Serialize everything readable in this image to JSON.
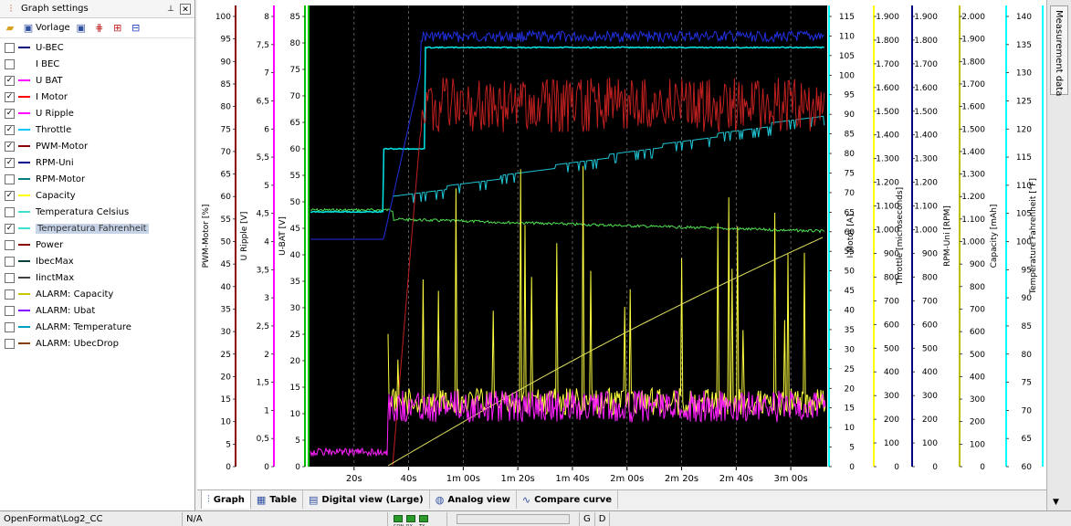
{
  "panel": {
    "title": "Graph settings",
    "toolbar": {
      "vorlage_label": "Vorlage"
    },
    "signals": [
      {
        "label": "U-BEC",
        "checked": false,
        "color": "#000080"
      },
      {
        "label": "I BEC",
        "checked": false,
        "color": "#ffffff"
      },
      {
        "label": "U BAT",
        "checked": true,
        "color": "#ff00ff"
      },
      {
        "label": "I Motor",
        "checked": true,
        "color": "#ff0000"
      },
      {
        "label": "U Ripple",
        "checked": true,
        "color": "#ff00ff"
      },
      {
        "label": "Throttle",
        "checked": true,
        "color": "#00c8ff"
      },
      {
        "label": "PWM-Motor",
        "checked": true,
        "color": "#8b0000"
      },
      {
        "label": "RPM-Uni",
        "checked": true,
        "color": "#00008b"
      },
      {
        "label": "RPM-Motor",
        "checked": false,
        "color": "#008080"
      },
      {
        "label": "Capacity",
        "checked": true,
        "color": "#ffff00"
      },
      {
        "label": "Temperatura Celsius",
        "checked": false,
        "color": "#40e0d0"
      },
      {
        "label": "Temperatura Fahrenheit",
        "checked": true,
        "color": "#40e0d0",
        "selected": true
      },
      {
        "label": "Power",
        "checked": false,
        "color": "#8b0000"
      },
      {
        "label": "IbecMax",
        "checked": false,
        "color": "#004040"
      },
      {
        "label": "IinctMax",
        "checked": false,
        "color": "#404040"
      },
      {
        "label": "ALARM: Capacity",
        "checked": false,
        "color": "#c8c800"
      },
      {
        "label": "ALARM: Ubat",
        "checked": false,
        "color": "#8000ff"
      },
      {
        "label": "ALARM: Temperature",
        "checked": false,
        "color": "#00a0c0"
      },
      {
        "label": "ALARM: UbecDrop",
        "checked": false,
        "color": "#804000"
      }
    ]
  },
  "graph": {
    "x_ticks": [
      "20s",
      "40s",
      "1m 00s",
      "1m 20s",
      "1m 40s",
      "2m 00s",
      "2m 20s",
      "2m 40s",
      "3m 00s"
    ],
    "axes_left": [
      {
        "label": "PWM-Motor [%]",
        "color": "#8b0000",
        "ticks": [
          "0",
          "5",
          "10",
          "15",
          "20",
          "25",
          "30",
          "35",
          "40",
          "45",
          "50",
          "55",
          "60",
          "65",
          "70",
          "75",
          "80",
          "85",
          "90",
          "95",
          "100"
        ]
      },
      {
        "label": "U Ripple [V]",
        "color": "#ff00ff",
        "ticks": [
          "0",
          "0,5",
          "1",
          "1,5",
          "2",
          "2,5",
          "3",
          "3,5",
          "4",
          "4,5",
          "5",
          "5,5",
          "6",
          "6,5",
          "7",
          "7,5",
          "8"
        ]
      },
      {
        "label": "U-BAT [V]",
        "color": "#00c000",
        "ticks": [
          "0",
          "5",
          "10",
          "15",
          "20",
          "25",
          "30",
          "35",
          "40",
          "45",
          "50",
          "55",
          "60",
          "65",
          "70",
          "75",
          "80",
          "85"
        ]
      }
    ],
    "axes_right": [
      {
        "label": "I-Motor [A]",
        "color": "#00ffff",
        "ticks": [
          "0",
          "5",
          "10",
          "15",
          "20",
          "25",
          "30",
          "35",
          "40",
          "45",
          "50",
          "55",
          "60",
          "65",
          "70",
          "75",
          "80",
          "85",
          "90",
          "95",
          "100",
          "105",
          "110",
          "115"
        ]
      },
      {
        "label": "Throttle [microseconds]",
        "color": "#ffff00",
        "ticks": [
          "0",
          "100",
          "200",
          "300",
          "400",
          "500",
          "600",
          "700",
          "800",
          "900",
          "1.000",
          "1.100",
          "1.200",
          "1.300",
          "1.400",
          "1.500",
          "1.600",
          "1.700",
          "1.800",
          "1.900"
        ]
      },
      {
        "label": "RPM-Uni [RPM]",
        "color": "#000080",
        "ticks": [
          "0",
          "100",
          "200",
          "300",
          "400",
          "500",
          "600",
          "700",
          "800",
          "900",
          "1.000",
          "1.100",
          "1.200",
          "1.300",
          "1.400",
          "1.500",
          "1.600",
          "1.700",
          "1.800",
          "1.900"
        ]
      },
      {
        "label": "Capacity [mAh]",
        "color": "#c0c000",
        "ticks": [
          "0",
          "100",
          "200",
          "300",
          "400",
          "500",
          "600",
          "700",
          "800",
          "900",
          "1.000",
          "1.100",
          "1.200",
          "1.300",
          "1.400",
          "1.500",
          "1.600",
          "1.700",
          "1.800",
          "1.900",
          "2.000"
        ]
      },
      {
        "label": "Temperature Fahrenheit [°F]",
        "color": "#00ffff",
        "ticks": [
          "60",
          "65",
          "70",
          "75",
          "80",
          "85",
          "90",
          "95",
          "100",
          "105",
          "110",
          "115",
          "120",
          "125",
          "130",
          "135",
          "140"
        ]
      }
    ]
  },
  "side_tab": {
    "label": "Measurement data"
  },
  "tabs": [
    {
      "label": "Graph",
      "active": true,
      "icon": "graph-icon"
    },
    {
      "label": "Table",
      "active": false,
      "icon": "table-icon"
    },
    {
      "label": "Digital view (Large)",
      "active": false,
      "icon": "digital-view-icon"
    },
    {
      "label": "Analog view",
      "active": false,
      "icon": "analog-view-icon"
    },
    {
      "label": "Compare curve",
      "active": false,
      "icon": "compare-curve-icon"
    }
  ],
  "status": {
    "file": "OpenFormat\\Log2_CC",
    "value": "N/A",
    "leds": [
      "CON",
      "RX",
      "TX"
    ],
    "g_label": "G",
    "d_label": "D"
  }
}
